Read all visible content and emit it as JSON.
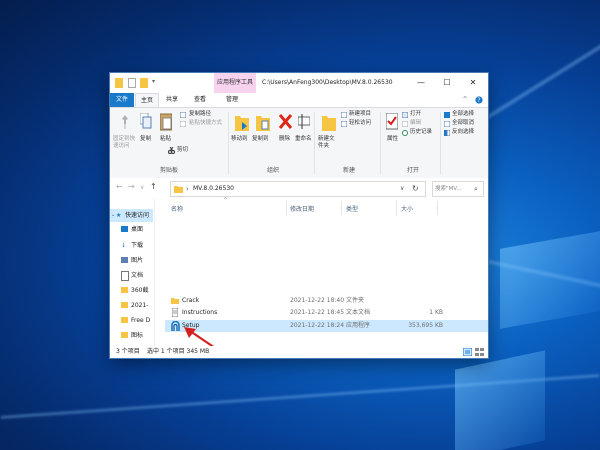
{
  "window": {
    "title_path": "C:\\Users\\AnFeng300\\Desktop\\MV.8.0.26530",
    "context_tab": "应用程序工具",
    "controls": {
      "minimize": "—",
      "maximize": "☐",
      "close": "✕"
    }
  },
  "ribbon_tabs": [
    "文件",
    "主页",
    "共享",
    "查看",
    "管理"
  ],
  "ribbon": {
    "clipboard": {
      "pin": "固定到快速访问",
      "copy": "复制",
      "paste": "粘贴",
      "copy_path": "复制路径",
      "paste_shortcut": "粘贴快捷方式",
      "cut": "剪切",
      "group": "剪贴板"
    },
    "organize": {
      "move_to": "移动到",
      "copy_to": "复制到",
      "delete": "删除",
      "rename": "重命名",
      "group": "组织"
    },
    "new": {
      "new_folder": "新建文件夹",
      "new_item": "新建项目",
      "easy_access": "轻松访问",
      "group": "新建"
    },
    "open": {
      "properties": "属性",
      "open": "打开",
      "edit": "编辑",
      "history": "历史记录",
      "group": "打开"
    },
    "select": {
      "select_all": "全部选择",
      "select_none": "全部取消",
      "invert": "反向选择"
    },
    "collapse": "^"
  },
  "address": {
    "back": "←",
    "forward": "→",
    "recent": "∨",
    "up": "↑",
    "separator": "›",
    "folder": "MV.8.0.26530",
    "dropdown": "∨",
    "refresh": "↻",
    "search_placeholder": "搜索\"MV...",
    "search_glyph": "⌕"
  },
  "sidebar": {
    "items": [
      "快速访问",
      "桌面",
      "下载",
      "图片",
      "文档",
      "360截",
      "2021-",
      "Free D",
      "图标"
    ]
  },
  "columns": {
    "name": "名称",
    "date": "修改日期",
    "type": "类型",
    "size": "大小",
    "sort": "^"
  },
  "files": [
    {
      "name": "Crack",
      "date": "2021-12-22 18:40",
      "type": "文件夹",
      "size": ""
    },
    {
      "name": "Instructions",
      "date": "2021-12-22 18:45",
      "type": "文本文档",
      "size": "1 KB"
    },
    {
      "name": "Setup",
      "date": "2021-12-22 18:24",
      "type": "应用程序",
      "size": "353,695 KB"
    }
  ],
  "status": {
    "count": "3 个项目",
    "selection": "选中 1 个项目  345 MB"
  },
  "colors": {
    "accent": "#1979ca",
    "selection": "#cce8ff",
    "arrow": "#d42020",
    "context_tab": "#f7d3f0"
  }
}
